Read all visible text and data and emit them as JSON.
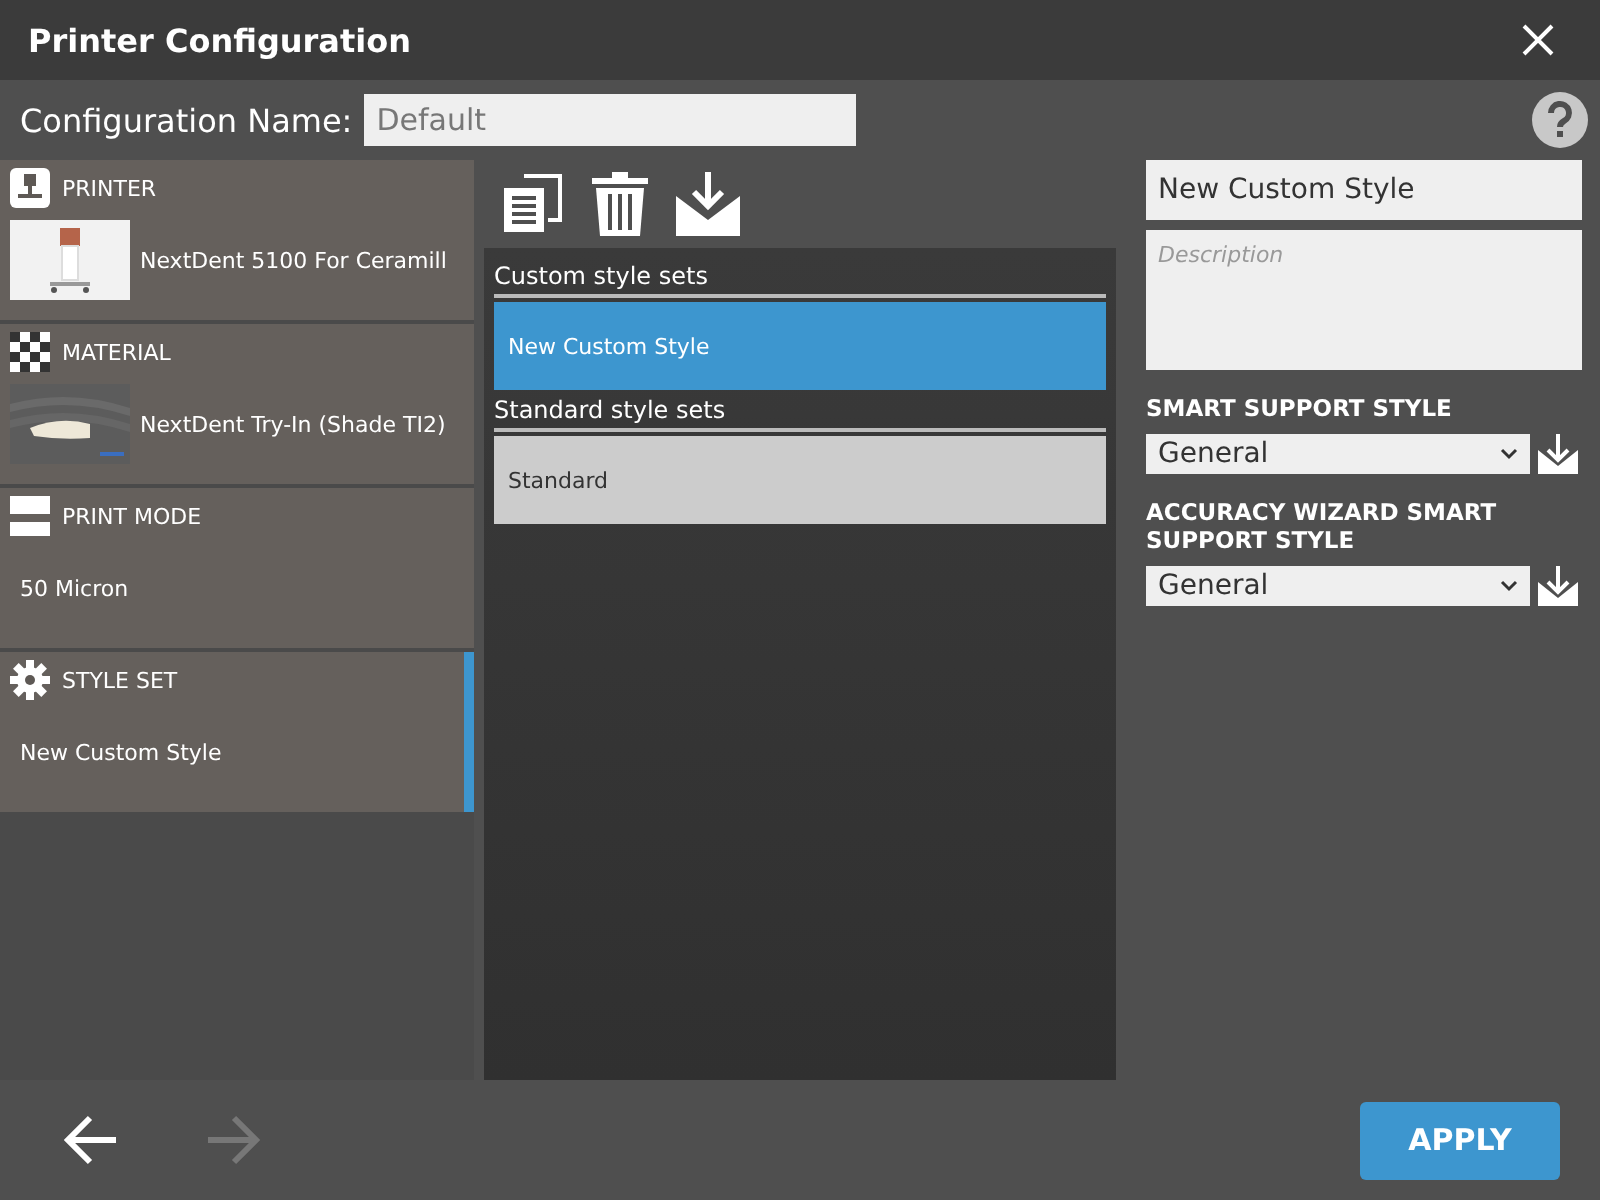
{
  "window": {
    "title": "Printer Configuration"
  },
  "config_name": {
    "label": "Configuration Name:",
    "value": "Default"
  },
  "categories": [
    {
      "kind": "printer",
      "label": "PRINTER",
      "value": "NextDent 5100 For Ceramill",
      "selected": false
    },
    {
      "kind": "material",
      "label": "MATERIAL",
      "value": "NextDent Try-In (Shade TI2)",
      "selected": false
    },
    {
      "kind": "mode",
      "label": "PRINT MODE",
      "value": "50 Micron",
      "selected": false
    },
    {
      "kind": "style",
      "label": "STYLE SET",
      "value": "New Custom Style",
      "selected": true
    }
  ],
  "style_groups": [
    {
      "title": "Custom style sets",
      "items": [
        {
          "label": "New Custom Style",
          "selected": true
        }
      ]
    },
    {
      "title": "Standard style sets",
      "items": [
        {
          "label": "Standard",
          "selected": false
        }
      ]
    }
  ],
  "details": {
    "name": "New Custom Style",
    "description_placeholder": "Description",
    "selects": [
      {
        "label": "SMART SUPPORT STYLE",
        "value": "General"
      },
      {
        "label": "ACCURACY WIZARD SMART SUPPORT STYLE",
        "value": "General"
      }
    ]
  },
  "footer": {
    "back_enabled": true,
    "forward_enabled": false,
    "apply": "APPLY"
  }
}
